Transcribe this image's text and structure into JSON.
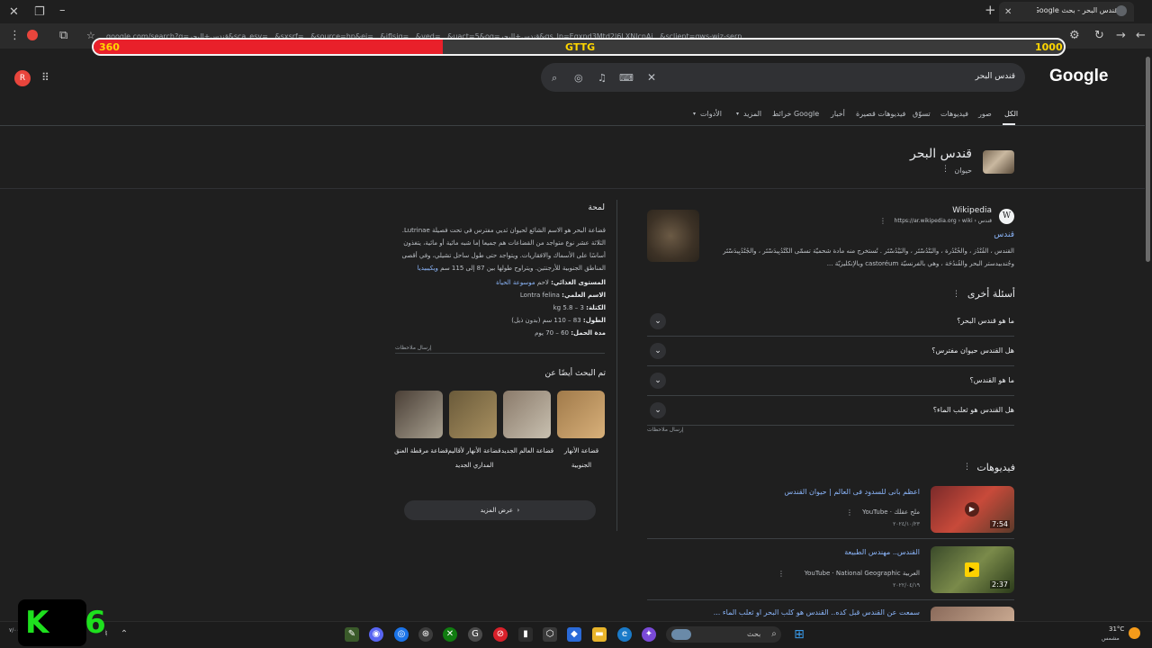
{
  "browser": {
    "tab_title": "قندس البحر - بحث Google",
    "url": "google.com/search?q=قندس+البحر&sca_esv=...&sxsrf=...&source=hp&ei=...&iflsig=...&ved=...&uact=5&oq=قندس+البحر&gs_lp=Egxnd3Mtd2l6LXNlcnAi...&sclient=gws-wiz-serp"
  },
  "overlay": {
    "left_value": "360",
    "center_label": "GTTG",
    "right_value": "1000",
    "fill_fraction": 0.36,
    "fill_color": "#e9202a"
  },
  "header": {
    "logo": "Google",
    "search_query": "قندس البحر",
    "avatar_letter": "R"
  },
  "nav_tabs": [
    "الكل",
    "صور",
    "فيديوهات",
    "تسوّق",
    "فيديوهات قصيرة",
    "أخبار",
    "خرائط Google",
    "المزيد",
    "الأدوات"
  ],
  "entity": {
    "title": "قندس البحر",
    "subtitle": "حيوان"
  },
  "knowledge_panel": {
    "heading": "لمحة",
    "description": "قضاعة البحر هو الاسم الشائع لحيوان ثديي مفترس في تحت فصيلة Lutrinae. الثلاثة عشر نوع متواجد من القضاعات هم جميعا إما شبه مائية أو مائية، يتغذون أساسًا على الأسماك والافقاريات. ويتواجد حتى طول ساحل تشيلي، وفي أقصى المناطق الجنوبية للأرجنتين. ويتراوح طولها بين 87 إلى 115 سم",
    "source_link": "ويكيبيديا",
    "facts": [
      {
        "label": "المستوى الغذائي:",
        "value": "لاحم",
        "extra": "موسوعة الحياة"
      },
      {
        "label": "الاسم العلمي:",
        "value": "Lontra felina"
      },
      {
        "label": "الكتلة:",
        "value": "3 – 5.8 kg"
      },
      {
        "label": "الطول:",
        "value": "83 – 110 سم (بدون ذيل)"
      },
      {
        "label": "مدة الحمل:",
        "value": "60 – 70 يوم"
      }
    ],
    "feedback": "إرسال ملاحظات",
    "also_searched_heading": "تم البحث أيضًا عن",
    "also_searched": [
      {
        "label": "قضاعة الأنهار الجنوبية",
        "color1": "#a07a4a",
        "color2": "#d8b07a"
      },
      {
        "label": "قضاعة العالم الجديد",
        "color1": "#8a7a6a",
        "color2": "#c8c0b0"
      },
      {
        "label": "قضاعة الأنهار لأقاليم المداري الجديد",
        "color1": "#6a5a3a",
        "color2": "#a89060"
      },
      {
        "label": "قضاعة مرقطة العنق",
        "color1": "#4a3f36",
        "color2": "#a8a090"
      }
    ],
    "more_button": "عرض المزيد"
  },
  "wiki_result": {
    "site_name": "Wikipedia",
    "url": "https://ar.wikipedia.org › wiki › قندس",
    "title": "قندس",
    "snippet": "القندس ، القُنْدُز ، والخُنْدُرة ، والبَنْدُسْتَر ، والبَيْدُسْتَر . تُستخرج منه مادة شحميّة تسمّى الكَنْدُبِيدَسْتَر ، والجُنْدُبِيدَسْتَر وجُندبيدستر البحر والقُندُحَة ، وهي بالفرنسيّة castoréum وبالإنكليزيّة ..."
  },
  "people_also_ask": {
    "heading": "أسئلة أخرى",
    "questions": [
      "ما هو قندس البحر؟",
      "هل القندس حيوان مفترس؟",
      "ما هو القندس؟",
      "هل القندس هو ثعلب الماء؟"
    ],
    "feedback": "إرسال ملاحظات"
  },
  "videos": {
    "heading": "فيديوهات",
    "items": [
      {
        "title": "اعظم بانى للسدود فى العالم | حيوان القندس",
        "source": "YouTube · ملح عقلك",
        "date": "٢٠٢٤/١٠/٢٣",
        "duration": "7:54"
      },
      {
        "title": "القندس.. مهندس الطبيعة",
        "source": "YouTube · National Geographic العربية",
        "date": "٢٠٢٢/٠٤/١٩",
        "duration": "2:37"
      },
      {
        "title": "سمعت عن القندس قبل كده.. القندس هو كلب البحر او ثعلب الماء ...",
        "source": "",
        "date": "",
        "duration": ""
      }
    ]
  },
  "taskbar": {
    "search_label": "بحث",
    "weather_temp": "31°C",
    "weather_desc": "مشمس",
    "clock": "٧/٠٠"
  },
  "watermark": "K 6"
}
